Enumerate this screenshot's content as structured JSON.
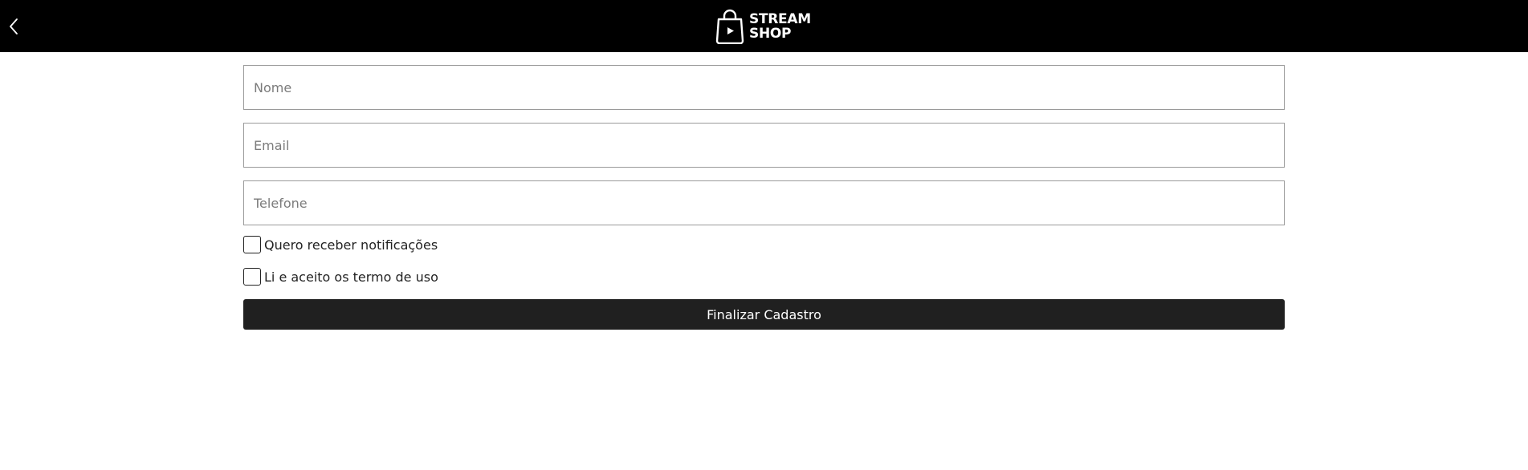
{
  "header": {
    "back_icon": "chevron-left-icon",
    "logo_icon": "shopping-bag-play-icon",
    "logo_line1": "STREAM",
    "logo_line2": "SHOP",
    "background": "#000000"
  },
  "form": {
    "name_placeholder": "Nome",
    "name_value": "",
    "email_placeholder": "Email",
    "email_value": "",
    "phone_placeholder": "Telefone",
    "phone_value": "",
    "notifications_label": "Quero receber notificações",
    "notifications_checked": false,
    "terms_label": "Li e aceito os termo de uso",
    "terms_checked": false,
    "submit_label": "Finalizar Cadastro",
    "submit_color": "#202020"
  }
}
